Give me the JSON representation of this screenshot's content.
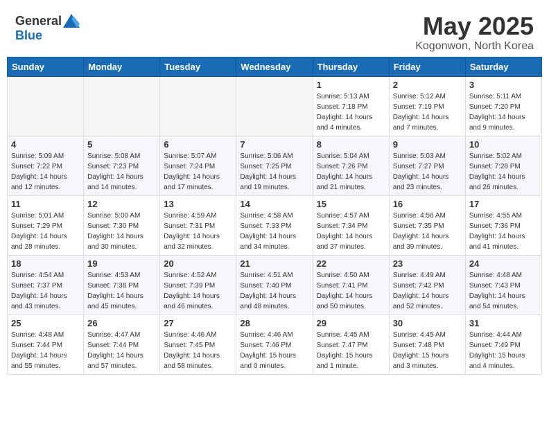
{
  "header": {
    "logo_general": "General",
    "logo_blue": "Blue",
    "title": "May 2025",
    "subtitle": "Kogonwon, North Korea"
  },
  "weekdays": [
    "Sunday",
    "Monday",
    "Tuesday",
    "Wednesday",
    "Thursday",
    "Friday",
    "Saturday"
  ],
  "weeks": [
    [
      {
        "day": "",
        "info": ""
      },
      {
        "day": "",
        "info": ""
      },
      {
        "day": "",
        "info": ""
      },
      {
        "day": "",
        "info": ""
      },
      {
        "day": "1",
        "info": "Sunrise: 5:13 AM\nSunset: 7:18 PM\nDaylight: 14 hours\nand 4 minutes."
      },
      {
        "day": "2",
        "info": "Sunrise: 5:12 AM\nSunset: 7:19 PM\nDaylight: 14 hours\nand 7 minutes."
      },
      {
        "day": "3",
        "info": "Sunrise: 5:11 AM\nSunset: 7:20 PM\nDaylight: 14 hours\nand 9 minutes."
      }
    ],
    [
      {
        "day": "4",
        "info": "Sunrise: 5:09 AM\nSunset: 7:22 PM\nDaylight: 14 hours\nand 12 minutes."
      },
      {
        "day": "5",
        "info": "Sunrise: 5:08 AM\nSunset: 7:23 PM\nDaylight: 14 hours\nand 14 minutes."
      },
      {
        "day": "6",
        "info": "Sunrise: 5:07 AM\nSunset: 7:24 PM\nDaylight: 14 hours\nand 17 minutes."
      },
      {
        "day": "7",
        "info": "Sunrise: 5:06 AM\nSunset: 7:25 PM\nDaylight: 14 hours\nand 19 minutes."
      },
      {
        "day": "8",
        "info": "Sunrise: 5:04 AM\nSunset: 7:26 PM\nDaylight: 14 hours\nand 21 minutes."
      },
      {
        "day": "9",
        "info": "Sunrise: 5:03 AM\nSunset: 7:27 PM\nDaylight: 14 hours\nand 23 minutes."
      },
      {
        "day": "10",
        "info": "Sunrise: 5:02 AM\nSunset: 7:28 PM\nDaylight: 14 hours\nand 26 minutes."
      }
    ],
    [
      {
        "day": "11",
        "info": "Sunrise: 5:01 AM\nSunset: 7:29 PM\nDaylight: 14 hours\nand 28 minutes."
      },
      {
        "day": "12",
        "info": "Sunrise: 5:00 AM\nSunset: 7:30 PM\nDaylight: 14 hours\nand 30 minutes."
      },
      {
        "day": "13",
        "info": "Sunrise: 4:59 AM\nSunset: 7:31 PM\nDaylight: 14 hours\nand 32 minutes."
      },
      {
        "day": "14",
        "info": "Sunrise: 4:58 AM\nSunset: 7:33 PM\nDaylight: 14 hours\nand 34 minutes."
      },
      {
        "day": "15",
        "info": "Sunrise: 4:57 AM\nSunset: 7:34 PM\nDaylight: 14 hours\nand 37 minutes."
      },
      {
        "day": "16",
        "info": "Sunrise: 4:56 AM\nSunset: 7:35 PM\nDaylight: 14 hours\nand 39 minutes."
      },
      {
        "day": "17",
        "info": "Sunrise: 4:55 AM\nSunset: 7:36 PM\nDaylight: 14 hours\nand 41 minutes."
      }
    ],
    [
      {
        "day": "18",
        "info": "Sunrise: 4:54 AM\nSunset: 7:37 PM\nDaylight: 14 hours\nand 43 minutes."
      },
      {
        "day": "19",
        "info": "Sunrise: 4:53 AM\nSunset: 7:38 PM\nDaylight: 14 hours\nand 45 minutes."
      },
      {
        "day": "20",
        "info": "Sunrise: 4:52 AM\nSunset: 7:39 PM\nDaylight: 14 hours\nand 46 minutes."
      },
      {
        "day": "21",
        "info": "Sunrise: 4:51 AM\nSunset: 7:40 PM\nDaylight: 14 hours\nand 48 minutes."
      },
      {
        "day": "22",
        "info": "Sunrise: 4:50 AM\nSunset: 7:41 PM\nDaylight: 14 hours\nand 50 minutes."
      },
      {
        "day": "23",
        "info": "Sunrise: 4:49 AM\nSunset: 7:42 PM\nDaylight: 14 hours\nand 52 minutes."
      },
      {
        "day": "24",
        "info": "Sunrise: 4:48 AM\nSunset: 7:43 PM\nDaylight: 14 hours\nand 54 minutes."
      }
    ],
    [
      {
        "day": "25",
        "info": "Sunrise: 4:48 AM\nSunset: 7:44 PM\nDaylight: 14 hours\nand 55 minutes."
      },
      {
        "day": "26",
        "info": "Sunrise: 4:47 AM\nSunset: 7:44 PM\nDaylight: 14 hours\nand 57 minutes."
      },
      {
        "day": "27",
        "info": "Sunrise: 4:46 AM\nSunset: 7:45 PM\nDaylight: 14 hours\nand 58 minutes."
      },
      {
        "day": "28",
        "info": "Sunrise: 4:46 AM\nSunset: 7:46 PM\nDaylight: 15 hours\nand 0 minutes."
      },
      {
        "day": "29",
        "info": "Sunrise: 4:45 AM\nSunset: 7:47 PM\nDaylight: 15 hours\nand 1 minute."
      },
      {
        "day": "30",
        "info": "Sunrise: 4:45 AM\nSunset: 7:48 PM\nDaylight: 15 hours\nand 3 minutes."
      },
      {
        "day": "31",
        "info": "Sunrise: 4:44 AM\nSunset: 7:49 PM\nDaylight: 15 hours\nand 4 minutes."
      }
    ]
  ]
}
